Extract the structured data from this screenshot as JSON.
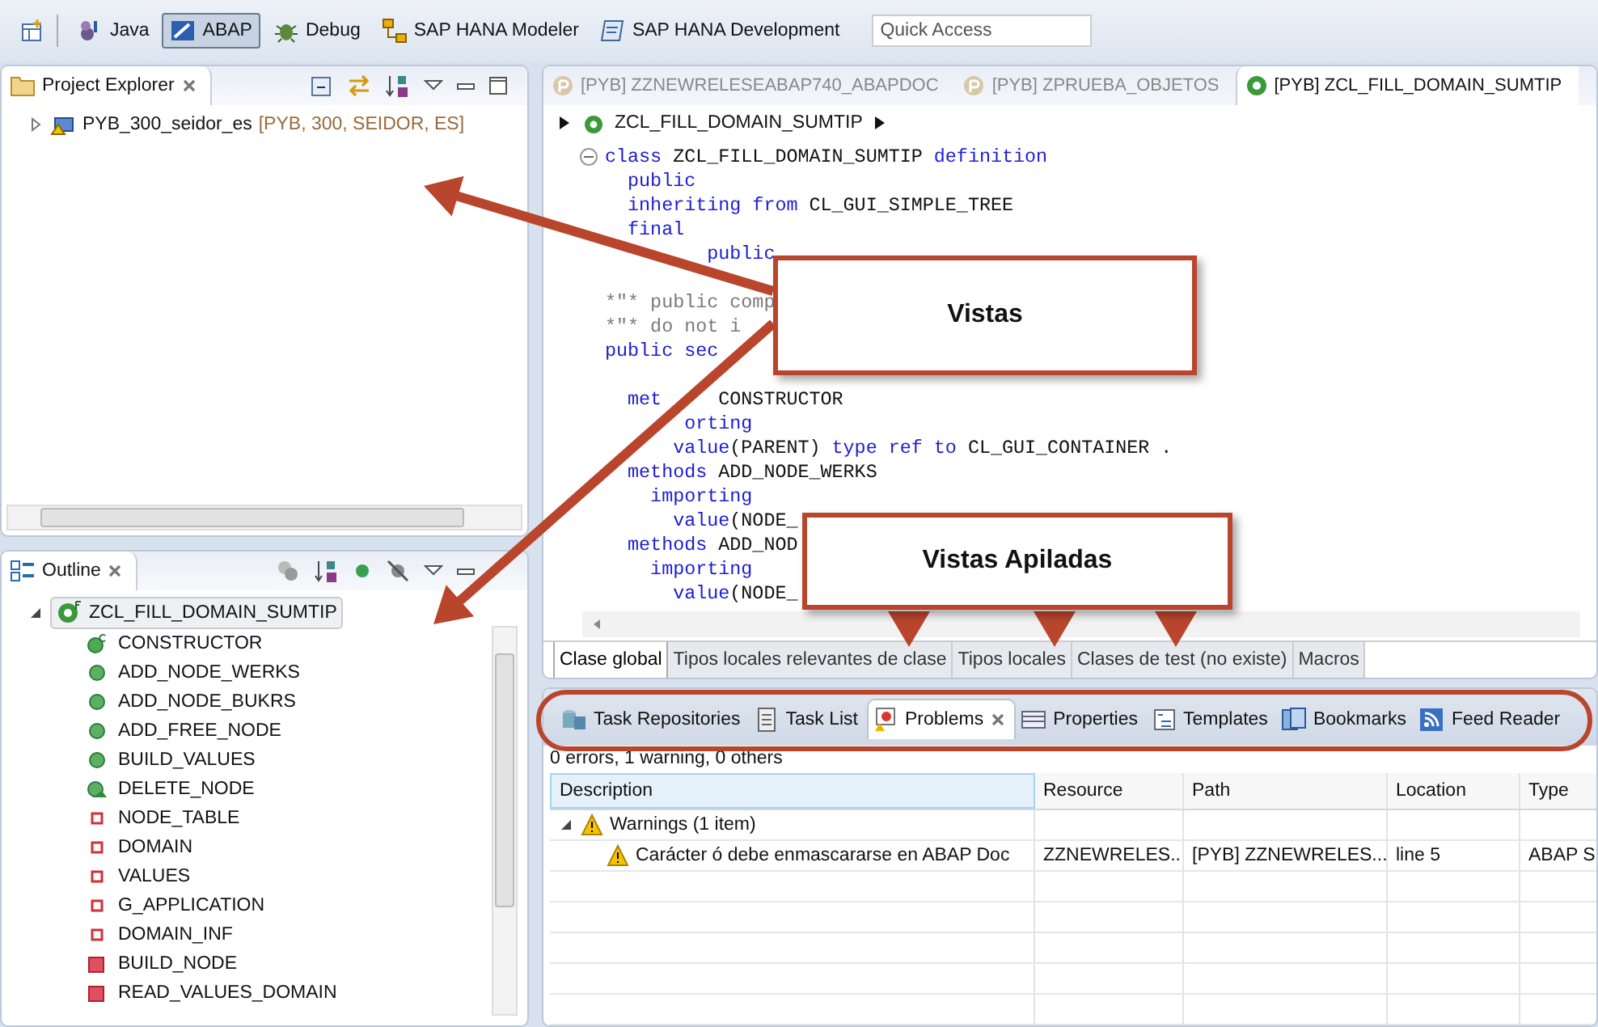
{
  "toolbar": {
    "perspectives": [
      {
        "label": "Java",
        "kind": "java",
        "selected": false
      },
      {
        "label": "ABAP",
        "kind": "abap",
        "selected": true
      },
      {
        "label": "Debug",
        "kind": "debug",
        "selected": false
      },
      {
        "label": "SAP HANA Modeler",
        "kind": "modeler",
        "selected": false
      },
      {
        "label": "SAP HANA Development",
        "kind": "development",
        "selected": false
      }
    ],
    "quick_access": {
      "placeholder": "Quick Access"
    }
  },
  "project_explorer": {
    "title": "Project Explorer",
    "items": [
      {
        "label": "PYB_300_seidor_es",
        "detail": "[PYB, 300, SEIDOR, ES]",
        "expanded": false
      }
    ]
  },
  "outline": {
    "title": "Outline",
    "root": {
      "label": "ZCL_FILL_DOMAIN_SUMTIP",
      "expanded": true,
      "selected": true,
      "children": [
        {
          "label": "CONSTRUCTOR",
          "kind": "constructor"
        },
        {
          "label": "ADD_NODE_WERKS",
          "kind": "public-method"
        },
        {
          "label": "ADD_NODE_BUKRS",
          "kind": "public-method"
        },
        {
          "label": "ADD_FREE_NODE",
          "kind": "public-method"
        },
        {
          "label": "BUILD_VALUES",
          "kind": "public-method"
        },
        {
          "label": "DELETE_NODE",
          "kind": "protected-method"
        },
        {
          "label": "NODE_TABLE",
          "kind": "private-attribute"
        },
        {
          "label": "DOMAIN",
          "kind": "private-attribute"
        },
        {
          "label": "VALUES",
          "kind": "private-attribute"
        },
        {
          "label": "G_APPLICATION",
          "kind": "private-attribute"
        },
        {
          "label": "DOMAIN_INF",
          "kind": "private-attribute"
        },
        {
          "label": "BUILD_NODE",
          "kind": "private-method"
        },
        {
          "label": "READ_VALUES_DOMAIN",
          "kind": "private-method"
        }
      ]
    }
  },
  "editor": {
    "tabs": [
      {
        "label": "[PYB] ZZNEWRELESEABAP740_ABAPDOC",
        "kind": "program",
        "selected": false
      },
      {
        "label": "[PYB] ZPRUEBA_OBJETOS",
        "kind": "program",
        "selected": false
      },
      {
        "label": "[PYB] ZCL_FILL_DOMAIN_SUMTIP",
        "kind": "class",
        "selected": true
      }
    ],
    "breadcrumb": "ZCL_FILL_DOMAIN_SUMTIP",
    "code": [
      {
        "foldable": true,
        "tokens": [
          {
            "kind": "keyword",
            "text": "class"
          },
          {
            "kind": "plain",
            "text": " ZCL_FILL_DOMAIN_SUMTIP "
          },
          {
            "kind": "keyword",
            "text": "definition"
          }
        ]
      },
      {
        "tokens": [
          {
            "kind": "keyword",
            "text": "  public"
          }
        ]
      },
      {
        "tokens": [
          {
            "kind": "keyword",
            "text": "  inheriting from"
          },
          {
            "kind": "plain",
            "text": " CL_GUI_SIMPLE_TREE"
          }
        ]
      },
      {
        "tokens": [
          {
            "kind": "keyword",
            "text": "  final"
          }
        ]
      },
      {
        "tokens": [
          {
            "kind": "keyword",
            "text": "         public"
          }
        ]
      },
      {
        "space_before": true,
        "tokens": [
          {
            "kind": "comment",
            "text": "*\"* public comp"
          }
        ]
      },
      {
        "tokens": [
          {
            "kind": "comment",
            "text": "*\"* do not i"
          }
        ]
      },
      {
        "tokens": [
          {
            "kind": "keyword",
            "text": "public sec"
          }
        ]
      },
      {
        "space_before": true,
        "tokens": [
          {
            "kind": "keyword",
            "text": "  met"
          },
          {
            "kind": "plain",
            "text": "     CONSTRUCTOR"
          }
        ]
      },
      {
        "tokens": [
          {
            "kind": "keyword",
            "text": "       orting"
          }
        ]
      },
      {
        "tokens": [
          {
            "kind": "keyword",
            "text": "      value"
          },
          {
            "kind": "plain",
            "text": "(PARENT) "
          },
          {
            "kind": "keyword",
            "text": "type ref to"
          },
          {
            "kind": "plain",
            "text": " CL_GUI_CONTAINER ."
          }
        ]
      },
      {
        "tokens": [
          {
            "kind": "keyword",
            "text": "  methods"
          },
          {
            "kind": "plain",
            "text": " ADD_NODE_WERKS"
          }
        ]
      },
      {
        "tokens": [
          {
            "kind": "keyword",
            "text": "    importing"
          }
        ]
      },
      {
        "tokens": [
          {
            "kind": "keyword",
            "text": "      value"
          },
          {
            "kind": "plain",
            "text": "(NODE_"
          }
        ]
      },
      {
        "tokens": [
          {
            "kind": "keyword",
            "text": "  methods"
          },
          {
            "kind": "plain",
            "text": " ADD_NOD"
          }
        ]
      },
      {
        "tokens": [
          {
            "kind": "keyword",
            "text": "    importing"
          }
        ]
      },
      {
        "tokens": [
          {
            "kind": "keyword",
            "text": "      value"
          },
          {
            "kind": "plain",
            "text": "(NODE_"
          }
        ]
      }
    ],
    "section_tabs": [
      {
        "label": "Clase global",
        "selected": true
      },
      {
        "label": "Tipos locales relevantes de clase",
        "selected": false
      },
      {
        "label": "Tipos locales",
        "selected": false
      },
      {
        "label": "Clases de test (no existe)",
        "selected": false
      },
      {
        "label": "Macros",
        "selected": false
      }
    ]
  },
  "problems": {
    "tabs": [
      {
        "label": "Task Repositories",
        "kind": "repositories",
        "selected": false
      },
      {
        "label": "Task List",
        "kind": "tasklist",
        "selected": false
      },
      {
        "label": "Problems",
        "kind": "problems",
        "selected": true
      },
      {
        "label": "Properties",
        "kind": "properties",
        "selected": false
      },
      {
        "label": "Templates",
        "kind": "templates",
        "selected": false
      },
      {
        "label": "Bookmarks",
        "kind": "bookmarks",
        "selected": false
      },
      {
        "label": "Feed Reader",
        "kind": "feed",
        "selected": false
      }
    ],
    "summary": "0 errors, 1 warning, 0 others",
    "columns": [
      "Description",
      "Resource",
      "Path",
      "Location",
      "Type"
    ],
    "groups": [
      {
        "label": "Warnings (1 item)",
        "expanded": true,
        "rows": [
          {
            "cells": [
              "Carácter ó debe enmascararse en ABAP Doc",
              "ZZNEWRELES...",
              "[PYB] ZZNEWRELES...",
              "line 5",
              "ABAP S"
            ]
          }
        ]
      }
    ]
  },
  "annotations": [
    {
      "kind": "callout",
      "text": "Vistas"
    },
    {
      "kind": "callout",
      "text": "Vistas Apiladas"
    }
  ]
}
